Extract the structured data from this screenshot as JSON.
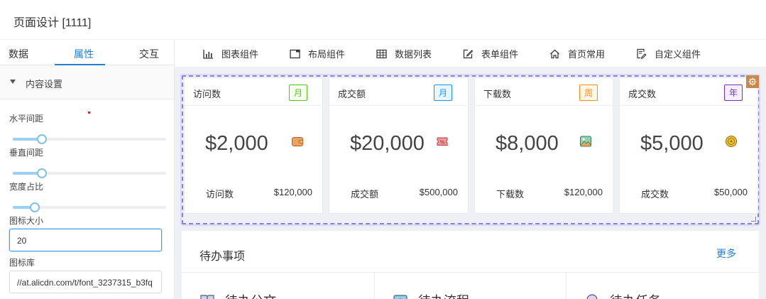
{
  "header": {
    "title": "页面设计 [1111]"
  },
  "sidebar": {
    "tabs": [
      "数据",
      "属性",
      "交互"
    ],
    "active_tab": "属性",
    "section_title": "内容设置",
    "fields": {
      "horizontal_spacing": {
        "label": "水平间距",
        "value_fraction": 0.15
      },
      "vertical_spacing": {
        "label": "垂直间距",
        "value_fraction": 0.15
      },
      "width_ratio": {
        "label": "宽度占比",
        "value_fraction": 0.1
      },
      "icon_size": {
        "label": "图标大小",
        "value": "20"
      },
      "icon_library": {
        "label": "图标库",
        "value": "//at.alicdn.com/t/font_3237315_b3fq"
      }
    }
  },
  "toolbar": {
    "items": [
      {
        "label": "图表组件",
        "icon": "bar-chart-icon"
      },
      {
        "label": "布局组件",
        "icon": "layout-window-icon"
      },
      {
        "label": "数据列表",
        "icon": "table-icon"
      },
      {
        "label": "表单组件",
        "icon": "edit-form-icon"
      },
      {
        "label": "首页常用",
        "icon": "home-icon"
      },
      {
        "label": "自定义组件",
        "icon": "custom-doc-icon"
      }
    ]
  },
  "stats": [
    {
      "name": "访问数",
      "tag": "月",
      "tag_color": "#52c41a",
      "tag_bg": "#f6ffed",
      "value": "$2,000",
      "icon": "wallet-icon",
      "foot_label": "访问数",
      "foot_value": "$120,000"
    },
    {
      "name": "成交额",
      "tag": "月",
      "tag_color": "#1890ff",
      "tag_bg": "#e6f7ff",
      "value": "$20,000",
      "icon": "coupon-icon",
      "foot_label": "成交额",
      "foot_value": "$500,000"
    },
    {
      "name": "下载数",
      "tag": "周",
      "tag_color": "#fa8c16",
      "tag_bg": "#fff7e6",
      "value": "$8,000",
      "icon": "picture-icon",
      "foot_label": "下载数",
      "foot_value": "$120,000"
    },
    {
      "name": "成交数",
      "tag": "年",
      "tag_color": "#722ed1",
      "tag_bg": "#f9f0ff",
      "value": "$5,000",
      "icon": "coin-icon",
      "foot_label": "成交数",
      "foot_value": "$50,000"
    }
  ],
  "todo": {
    "title": "待办事项",
    "more": "更多",
    "items": [
      {
        "label": "待办公文",
        "icon": "book-icon"
      },
      {
        "label": "待办流程",
        "icon": "flow-icon"
      },
      {
        "label": "待办任务",
        "icon": "task-icon"
      }
    ]
  },
  "colors": {
    "accent": "#1f7fd3",
    "selection": "#8a7cf0",
    "canvas_bg": "#eef0f5"
  }
}
